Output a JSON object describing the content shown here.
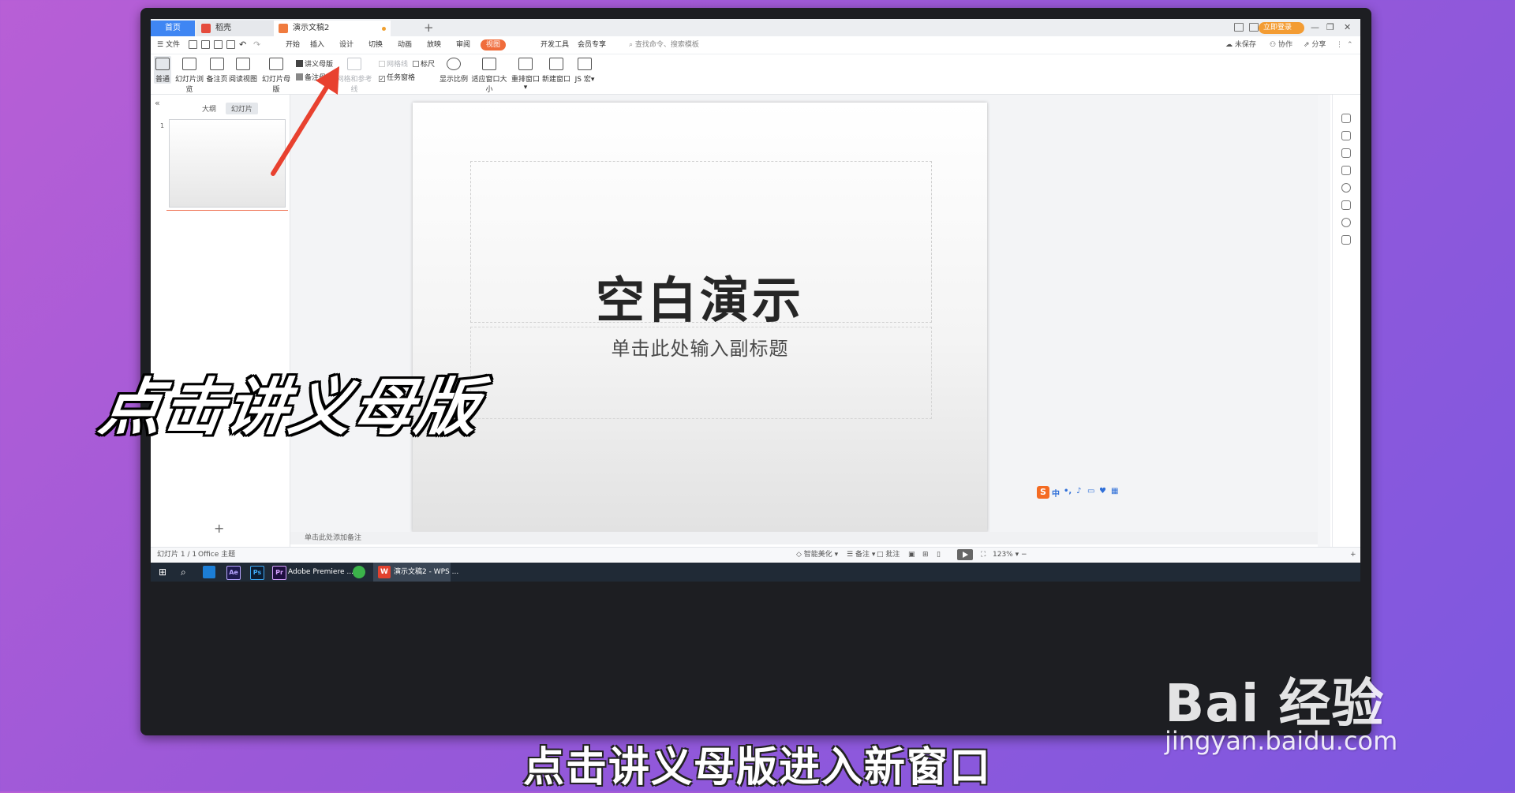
{
  "tabs": {
    "home": "首页",
    "daoke": "稻壳",
    "document": "演示文稿2",
    "login": "立即登录"
  },
  "menu": {
    "file": "文件",
    "items": [
      "开始",
      "插入",
      "设计",
      "切换",
      "动画",
      "放映",
      "审阅",
      "视图",
      "开发工具",
      "会员专享"
    ],
    "active": "视图",
    "search": "查找命令、搜索模板",
    "unsaved": "未保存",
    "collab": "协作",
    "share": "分享"
  },
  "ribbon": {
    "normal": "普通",
    "slide_browse": "幻灯片浏览",
    "notes_page": "备注页",
    "reading_view": "阅读视图",
    "slide_master": "幻灯片母版",
    "handout_master": "讲义母版",
    "notes_master": "备注母版",
    "grid_guides": "网格和参考线",
    "gridlines": "网格线",
    "ruler": "标尺",
    "task_pane": "任务窗格",
    "zoom": "显示比例",
    "fit_window": "适应窗口大小",
    "arrange": "重排窗口",
    "new_window": "新建窗口",
    "js_macro": "JS 宏"
  },
  "left_panel": {
    "outline": "大纲",
    "slides": "幻灯片",
    "slide_number": "1"
  },
  "slide": {
    "title": "空白演示",
    "subtitle": "单击此处输入副标题"
  },
  "notes_placeholder": "单击此处添加备注",
  "status": {
    "slide_count": "幻灯片 1 / 1",
    "theme": "Office 主题",
    "beautify": "智能美化",
    "notes": "备注",
    "comments": "批注",
    "zoom": "123%"
  },
  "taskbar": {
    "premiere": "Adobe Premiere ...",
    "wps": "演示文稿2 - WPS ...",
    "ae": "Ae",
    "ps": "Ps",
    "pr": "Pr"
  },
  "ime": {
    "label": "中"
  },
  "overlay": {
    "big_caption": "点击讲义母版",
    "subtitle": "点击讲义母版进入新窗口",
    "watermark_logo": "Bai 经验",
    "watermark_url": "jingyan.baidu.com"
  },
  "colors": {
    "accent_tab": "#3f86f3",
    "active_menu": "#f06c3b",
    "arrow": "#e8412f",
    "login": "#f39c33"
  }
}
